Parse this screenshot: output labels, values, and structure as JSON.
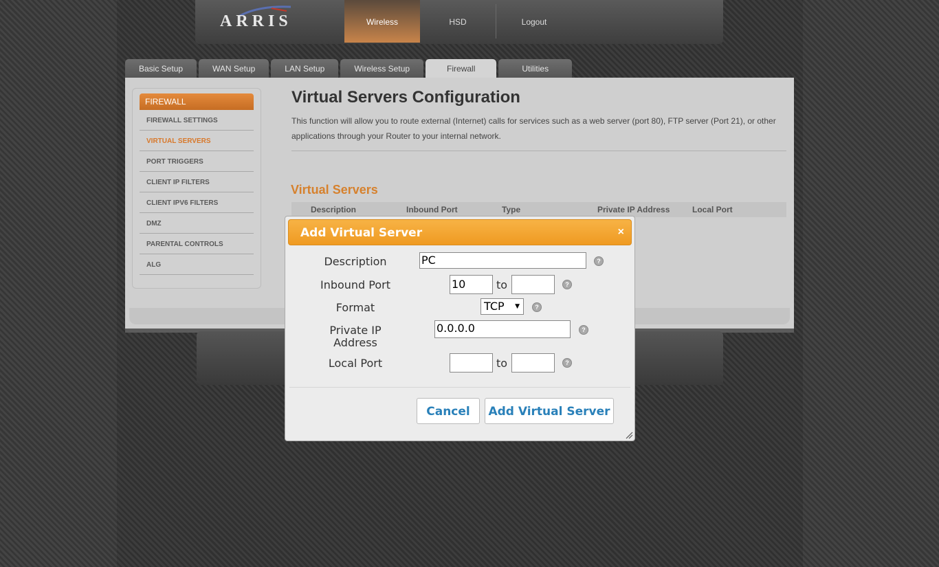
{
  "brand": {
    "logo_text": "ARRIS"
  },
  "top_nav": [
    {
      "label": "Wireless",
      "active": true
    },
    {
      "label": "HSD",
      "active": false
    },
    {
      "label": "Logout",
      "active": false
    }
  ],
  "tabs": [
    {
      "label": "Basic Setup",
      "active": false
    },
    {
      "label": "WAN Setup",
      "active": false
    },
    {
      "label": "LAN Setup",
      "active": false
    },
    {
      "label": "Wireless Setup",
      "active": false
    },
    {
      "label": "Firewall",
      "active": true
    },
    {
      "label": "Utilities",
      "active": false
    }
  ],
  "sidebar": {
    "header": "FIREWALL",
    "items": [
      {
        "label": "FIREWALL SETTINGS",
        "active": false
      },
      {
        "label": "VIRTUAL SERVERS",
        "active": true
      },
      {
        "label": "PORT TRIGGERS",
        "active": false
      },
      {
        "label": "CLIENT IP FILTERS",
        "active": false
      },
      {
        "label": "CLIENT IPV6 FILTERS",
        "active": false
      },
      {
        "label": "DMZ",
        "active": false
      },
      {
        "label": "PARENTAL CONTROLS",
        "active": false
      },
      {
        "label": "ALG",
        "active": false
      }
    ]
  },
  "main": {
    "title": "Virtual Servers Configuration",
    "description": "This function will allow you to route external (Internet) calls for services such as a web server (port 80), FTP server (Port 21), or other applications through your Router to your internal network.",
    "section_title": "Virtual Servers",
    "table_headers": [
      "Description",
      "Inbound Port",
      "Type",
      "Private IP Address",
      "Local Port"
    ]
  },
  "modal": {
    "title": "Add Virtual Server",
    "close": "×",
    "description_label": "Description",
    "description_value": "PC",
    "inbound_label": "Inbound Port",
    "inbound_from": "10",
    "inbound_to": "",
    "to_label": "to",
    "format_label": "Format",
    "format_value": "TCP",
    "private_ip_label_1": "Private IP",
    "private_ip_label_2": "Address",
    "private_ip_value": "0.0.0.0",
    "local_port_label": "Local Port",
    "local_from": "",
    "local_to": "",
    "help": "?",
    "cancel_label": "Cancel",
    "submit_label": "Add Virtual Server"
  },
  "colors": {
    "accent_orange": "#ef9a22",
    "link_blue": "#2980b9",
    "section_orange": "#d6812d"
  }
}
